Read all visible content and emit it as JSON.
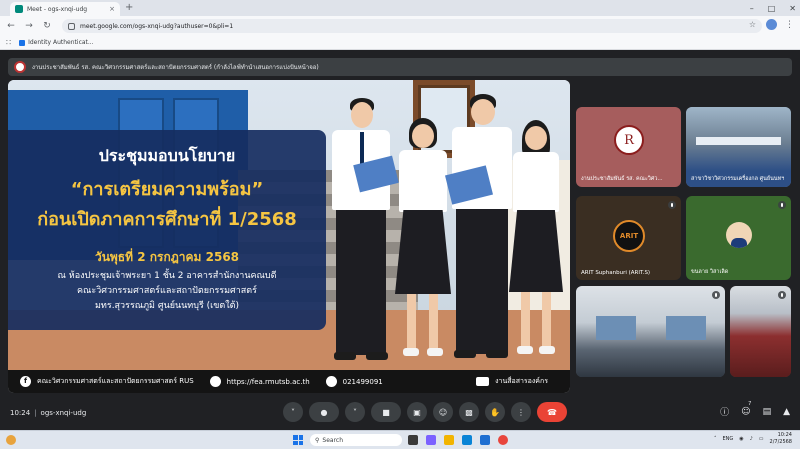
{
  "browser": {
    "tab_title": "Meet - ogs-xnqi-udg",
    "url": "meet.google.com/ogs-xnqi-udg?authuser=0&pli=1",
    "bookmark": "Identity Authenticat...",
    "new_tab_symbol": "+",
    "close_symbol": "×"
  },
  "meet": {
    "header_title": "งานประชาสัมพันธ์ รส. คณะวิศวกรรมศาสตร์และสถาปัตยกรรมศาสตร์ (กำลังไลฟ์ทำนำเสนอการแบ่งปันหน้าจอ)",
    "presentation": {
      "line1": "ประชุมมอบนโยบาย",
      "line2": "“การเตรียมความพร้อม”",
      "line3": "ก่อนเปิดภาคการศึกษาที่ 1/2568",
      "line4": "วันพุธที่ 2 กรกฎาคม 2568",
      "line5": "ณ ห้องประชุมเจ้าพระยา 1 ชั้น 2 อาคารสำนักงานคณบดี",
      "line6": "คณะวิศวกรรมศาสตร์และสถาปัตยกรรมศาสตร์",
      "line7": "มทร.สุวรรณภูมิ ศูนย์นนทบุรี (เขตใต้)",
      "footer_facebook_icon": "f",
      "footer_facebook": "คณะวิศวกรรมศาสตร์และสถาปัตยกรรมศาสตร์ RUS",
      "footer_web": "https://fea.rmutsb.ac.th",
      "footer_phone": "021499091",
      "footer_camera": "งานสื่อสารองค์กร"
    },
    "participants": [
      {
        "name": "งานประชาสัมพันธ์ รส. คณะวิศว...",
        "logo_letters": "R"
      },
      {
        "name": "สาขาวิชาวิศวกรรมเครื่องกล ศูนย์นนทฯ"
      },
      {
        "name": "ARIT Suphanburi (ARIT.S)",
        "logo_letters": "ARIT"
      },
      {
        "name": "ขนลาย วิสาเลิด"
      },
      {
        "name": ""
      },
      {
        "name": ""
      }
    ],
    "controls": {
      "time": "10:24",
      "separator": "|",
      "meeting_code": "ogs-xnqi-udg",
      "participants_count": "7"
    }
  },
  "taskbar": {
    "search_placeholder": "Search",
    "lang": "ENG",
    "time": "10:24",
    "date": "2/7/2568"
  },
  "colors": {
    "meet_bg": "#202124",
    "card_bg": "#162d60",
    "title_gold": "#f5c542",
    "end_call_red": "#ea4335"
  }
}
